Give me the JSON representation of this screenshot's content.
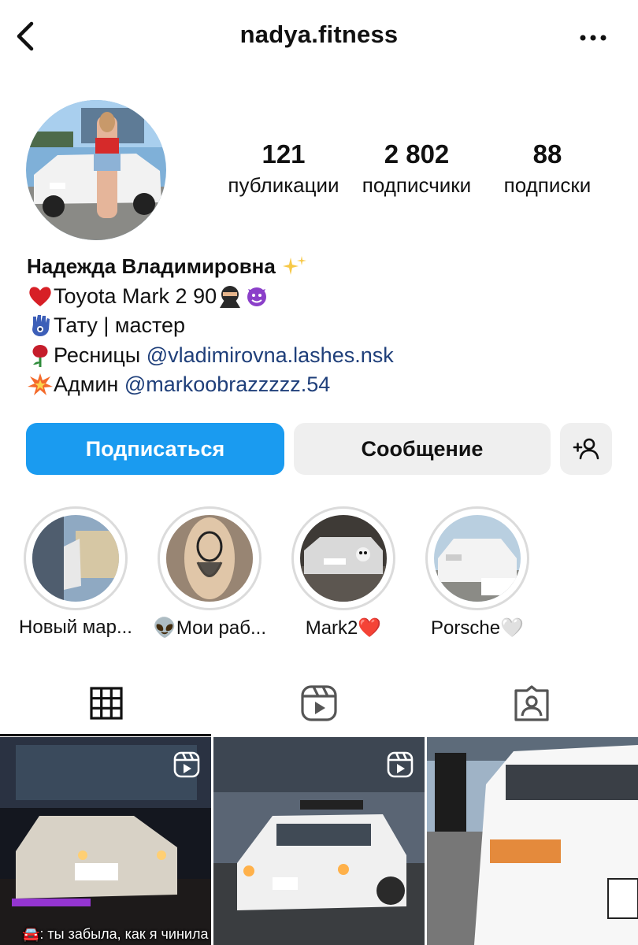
{
  "header": {
    "username": "nadya.fitness"
  },
  "stats": {
    "posts_count": "121",
    "posts_label": "публикации",
    "followers_count": "2 802",
    "followers_label": "подписчики",
    "following_count": "88",
    "following_label": "подписки"
  },
  "bio": {
    "name": "Надежда Владимировна",
    "line1": "Toyota Mark 2 90",
    "line2": "Тату | мастер",
    "line3_text": "Ресницы ",
    "line3_link": "@vladimirovna.lashes.nsk",
    "line4_text": "Админ ",
    "line4_link": "@markoobrazzzzz.54"
  },
  "actions": {
    "follow_label": "Подписаться",
    "message_label": "Сообщение"
  },
  "highlights": [
    {
      "label": "Новый мар..."
    },
    {
      "label": "👽Мои раб..."
    },
    {
      "label": "Mark2❤️"
    },
    {
      "label": "Porsche🤍"
    }
  ],
  "tabs": [
    {
      "icon": "grid-icon",
      "active": true
    },
    {
      "icon": "reels-icon",
      "active": false
    },
    {
      "icon": "tagged-icon",
      "active": false
    }
  ],
  "posts": [
    {
      "type": "reel",
      "caption": "🚘: ты забыла, как я чинила"
    },
    {
      "type": "reel"
    },
    {
      "type": "photo"
    }
  ],
  "colors": {
    "follow_button": "#1a9bf0",
    "secondary_button": "#efefef",
    "link": "#1f3f7a",
    "ring": "#dbdbdb"
  }
}
